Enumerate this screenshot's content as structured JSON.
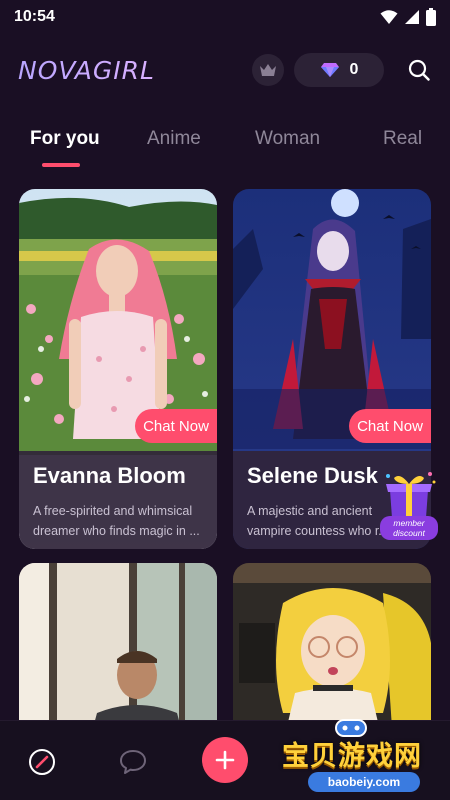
{
  "status_bar": {
    "time": "10:54"
  },
  "header": {
    "logo": "NOVAGIRL",
    "gem_count": "0"
  },
  "tabs": [
    {
      "label": "For you",
      "active": true
    },
    {
      "label": "Anime",
      "active": false
    },
    {
      "label": "Woman",
      "active": false
    },
    {
      "label": "Real",
      "active": false
    }
  ],
  "cards": [
    {
      "name": "Evanna Bloom",
      "description": "A free-spirited and whimsical dreamer who finds magic in ...",
      "chat_label": "Chat Now"
    },
    {
      "name": "Selene Dusk",
      "description": "A majestic and ancient vampire countess who r...",
      "chat_label": "Chat Now"
    },
    {
      "name": "",
      "description": ""
    },
    {
      "name": "",
      "description": ""
    }
  ],
  "promo": {
    "line1": "member",
    "line2": "discount"
  },
  "watermark": {
    "title": "宝贝游戏网",
    "url": "baobeiy.com"
  },
  "colors": {
    "accent": "#ff4d6d",
    "background": "#1a0f24",
    "card_info_bg": "#30243a"
  },
  "icons": [
    "wifi-icon",
    "signal-icon",
    "battery-icon",
    "crown-icon",
    "gem-icon",
    "search-icon",
    "compass-icon",
    "chat-bubble-icon",
    "plus-icon"
  ]
}
